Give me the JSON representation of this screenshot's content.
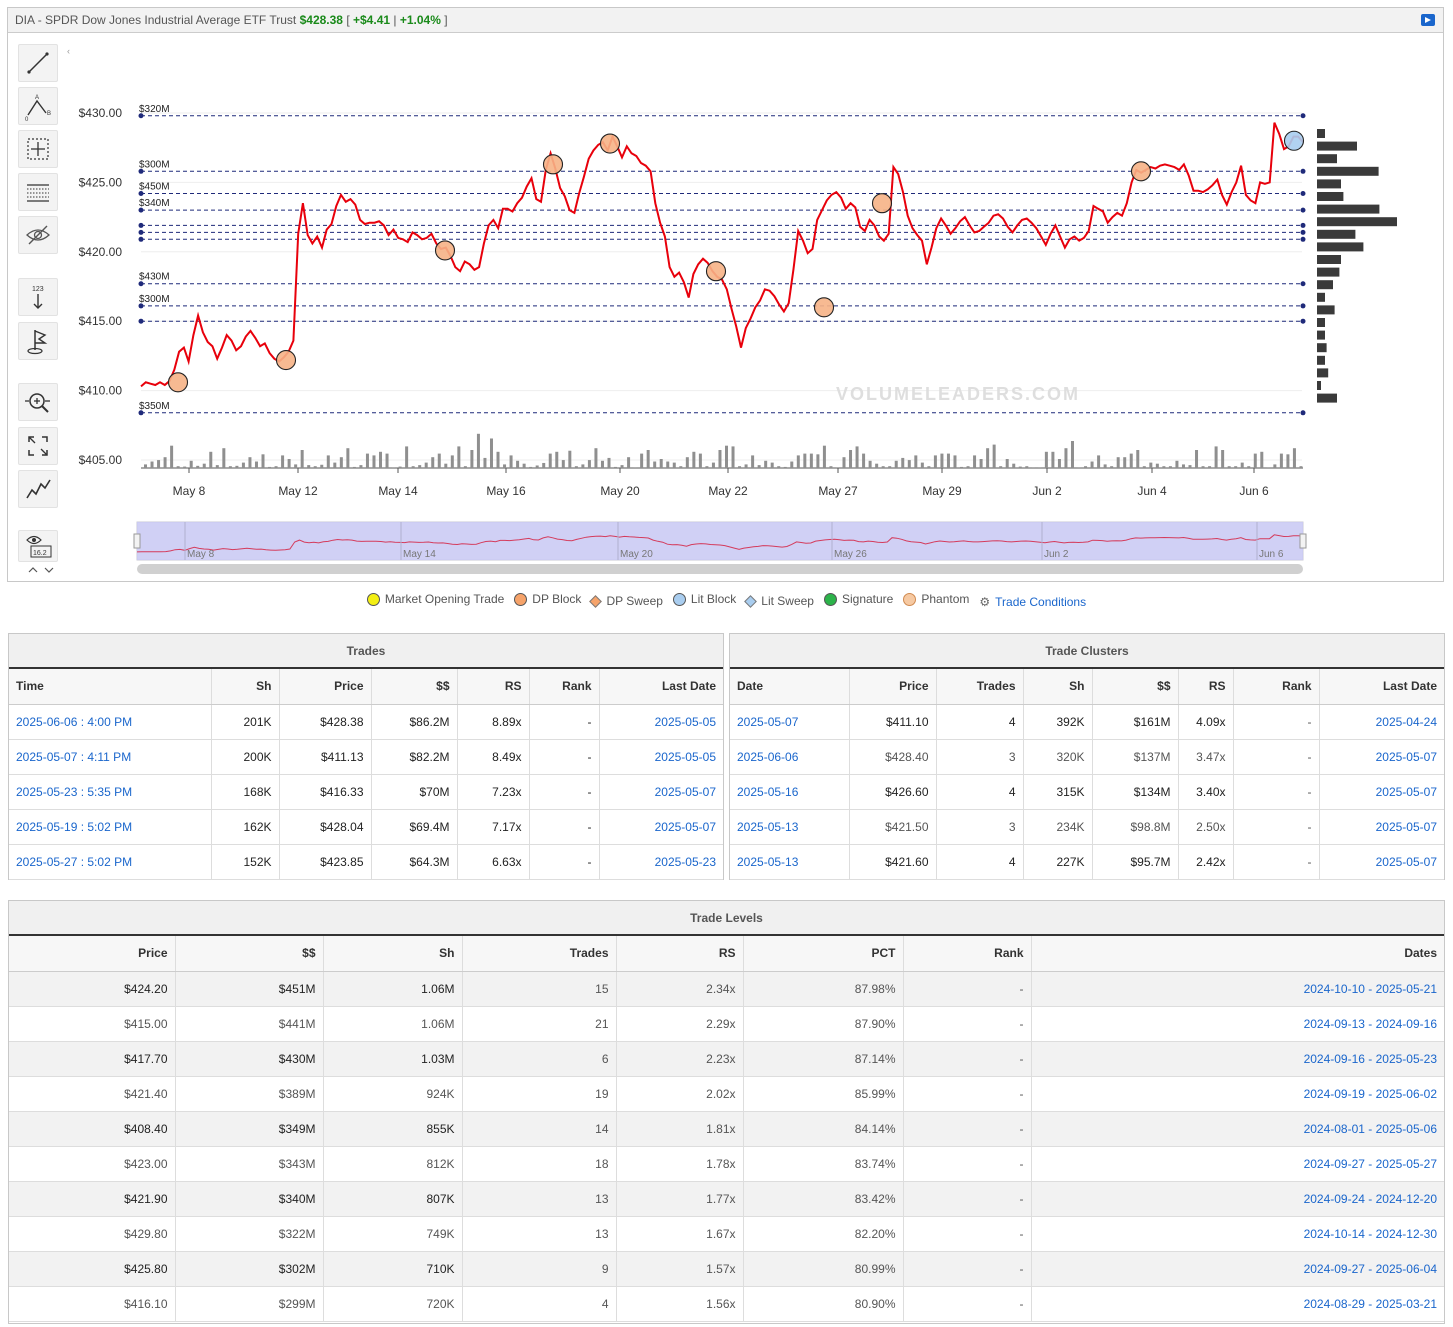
{
  "header": {
    "ticker": "DIA",
    "name": "SPDR Dow Jones Industrial Average ETF Trust",
    "price": "$428.38",
    "change": "+$4.41",
    "change_pct": "+1.04%"
  },
  "toolbar": {
    "tools": [
      "trend-line-icon",
      "abc-pattern-icon",
      "crosshair-icon",
      "grid-icon",
      "hide-icon",
      "measure-icon",
      "flag-icon",
      "zoom-icon",
      "fullscreen-icon",
      "line-chart-icon",
      "eye-value-icon"
    ],
    "eye_value": "16.2",
    "collapse": "‹"
  },
  "watermark": "VOLUMELEADERS.COM",
  "chart_data": {
    "type": "line",
    "title": "",
    "ylim": [
      403.8,
      434.4
    ],
    "y_ticks": [
      405,
      410,
      415,
      420,
      425,
      430
    ],
    "y_tick_labels": [
      "$405.00",
      "$410.00",
      "$415.00",
      "$420.00",
      "$425.00",
      "$430.00"
    ],
    "x_tick_labels": [
      "May 8",
      "May 12",
      "May 14",
      "May 16",
      "May 20",
      "May 22",
      "May 27",
      "May 29",
      "Jun 2",
      "Jun 4",
      "Jun 6"
    ],
    "price_series": [
      {
        "name": "price",
        "values": [
          410.3,
          410.6,
          410.5,
          410.4,
          410.6,
          410.4,
          410.7,
          411.5,
          412.8,
          413.1,
          412.1,
          414.0,
          415.4,
          414.2,
          413.5,
          413.2,
          412.3,
          413.1,
          414.0,
          413.6,
          412.9,
          413.2,
          413.9,
          414.3,
          413.8,
          413.2,
          413.4,
          412.7,
          412.3,
          412.1,
          412.4,
          412.8,
          413.6,
          421.3,
          423.5,
          421.2,
          420.6,
          421.1,
          420.3,
          421.6,
          422.0,
          423.3,
          424.1,
          423.6,
          423.8,
          423.4,
          422.3,
          422.0,
          422.1,
          422.1,
          422.2,
          421.9,
          421.2,
          421.6,
          421.0,
          420.9,
          420.7,
          421.4,
          421.2,
          420.9,
          421.0,
          421.3,
          420.6,
          420.2,
          420.3,
          419.7,
          418.9,
          418.6,
          419.3,
          419.1,
          418.7,
          418.9,
          420.6,
          421.9,
          422.3,
          421.7,
          423.1,
          423.1,
          422.9,
          423.5,
          423.9,
          424.7,
          425.3,
          423.8,
          423.6,
          425.9,
          427.1,
          426.0,
          424.6,
          424.0,
          423.0,
          422.8,
          424.2,
          425.4,
          426.7,
          427.3,
          427.7,
          427.9,
          427.3,
          428.3,
          427.6,
          426.8,
          427.6,
          427.1,
          426.9,
          426.4,
          426.2,
          425.8,
          423.5,
          422.1,
          421.1,
          418.9,
          418.2,
          418.5,
          417.8,
          416.7,
          418.4,
          419.1,
          419.5,
          419.2,
          418.6,
          418.2,
          418.0,
          417.3,
          415.9,
          414.6,
          413.1,
          414.5,
          415.2,
          416.0,
          416.5,
          417.3,
          417.2,
          416.8,
          416.2,
          415.7,
          416.3,
          418.7,
          421.5,
          420.8,
          419.9,
          420.2,
          422.3,
          423.0,
          423.7,
          424.1,
          424.3,
          423.9,
          423.1,
          423.5,
          423.2,
          421.8,
          421.5,
          422.3,
          421.9,
          421.1,
          420.8,
          421.3,
          426.1,
          425.6,
          424.3,
          422.6,
          421.7,
          421.2,
          420.8,
          419.1,
          420.3,
          421.7,
          422.4,
          421.9,
          421.3,
          421.7,
          422.2,
          422.5,
          421.9,
          421.4,
          421.5,
          421.8,
          422.1,
          422.6,
          422.7,
          422.4,
          421.8,
          421.4,
          421.9,
          422.3,
          422.4,
          422.1,
          421.7,
          421.1,
          420.5,
          421.3,
          421.9,
          421.1,
          420.3,
          420.9,
          421.1,
          420.8,
          421.0,
          421.5,
          423.3,
          423.1,
          422.9,
          422.1,
          422.5,
          422.8,
          422.6,
          423.5,
          425.0,
          425.9,
          425.7,
          425.9,
          426.1,
          426.0,
          426.2,
          426.3,
          426.2,
          426.1,
          425.9,
          426.3,
          425.5,
          424.4,
          424.4,
          424.3,
          424.5,
          424.8,
          425.2,
          424.1,
          423.4,
          424.3,
          425.0,
          426.2,
          424.1,
          423.7,
          423.5,
          425.0,
          424.9,
          425.0,
          429.3,
          428.5,
          427.4,
          427.6,
          428.3,
          428.3,
          427.9
        ]
      }
    ],
    "trade_markers": [
      {
        "type": "DP Block",
        "price": 410.6
      },
      {
        "type": "DP Block",
        "price": 412.2
      },
      {
        "type": "DP Block",
        "price": 420.1
      },
      {
        "type": "DP Block",
        "price": 426.3
      },
      {
        "type": "DP Block",
        "price": 427.8
      },
      {
        "type": "DP Block",
        "price": 418.6
      },
      {
        "type": "DP Block",
        "price": 416.0
      },
      {
        "type": "DP Block",
        "price": 423.5
      },
      {
        "type": "DP Block",
        "price": 425.8
      },
      {
        "type": "Lit Block",
        "price": 428.0
      }
    ],
    "levels": [
      {
        "price": 429.8,
        "label": "$320M"
      },
      {
        "price": 425.8,
        "label": "$300M"
      },
      {
        "price": 424.2,
        "label": "$450M"
      },
      {
        "price": 423.0,
        "label": "$340M"
      },
      {
        "price": 421.9,
        "label": ""
      },
      {
        "price": 421.4,
        "label": ""
      },
      {
        "price": 420.9,
        "label": ""
      },
      {
        "price": 417.7,
        "label": "$430M"
      },
      {
        "price": 416.1,
        "label": "$300M"
      },
      {
        "price": 415.0,
        "label": ""
      },
      {
        "price": 408.4,
        "label": "$350M"
      }
    ],
    "volume_bars": [
      0.1,
      0.18,
      0.22,
      0.3,
      0.62,
      0.05,
      0.04,
      0.2,
      0.06,
      0.12,
      0.45,
      0.08,
      0.55,
      0.05,
      0.06,
      0.15,
      0.3,
      0.18,
      0.38,
      0.03,
      0.05,
      0.35,
      0.25,
      0.1,
      0.5,
      0.08,
      0.05,
      0.09,
      0.35,
      0.15,
      0.3,
      0.55,
      0.03,
      0.08,
      0.4,
      0.35,
      0.45,
      0.4,
      0.02,
      0.04,
      0.6,
      0.05,
      0.08,
      0.15,
      0.3,
      0.4,
      0.12,
      0.35,
      0.6,
      0.05,
      0.5,
      0.95,
      0.28,
      0.82,
      0.45,
      0.1,
      0.35,
      0.2,
      0.12,
      0.03,
      0.07,
      0.14,
      0.4,
      0.45,
      0.22,
      0.48,
      0.05,
      0.1,
      0.22,
      0.55,
      0.2,
      0.28,
      0.03,
      0.08,
      0.3,
      0.02,
      0.4,
      0.5,
      0.18,
      0.25,
      0.18,
      0.15,
      0.05,
      0.3,
      0.45,
      0.4,
      0.05,
      0.15,
      0.5,
      0.62,
      0.6,
      0.05,
      0.1,
      0.35,
      0.08,
      0.2,
      0.15,
      0.05,
      0.03,
      0.18,
      0.35,
      0.4,
      0.4,
      0.38,
      0.62,
      0.05,
      0.02,
      0.3,
      0.5,
      0.6,
      0.4,
      0.2,
      0.12,
      0.05,
      0.05,
      0.2,
      0.28,
      0.22,
      0.35,
      0.15,
      0.05,
      0.35,
      0.4,
      0.4,
      0.35,
      0.03,
      0.05,
      0.35,
      0.25,
      0.55,
      0.65,
      0.05,
      0.25,
      0.12,
      0.04,
      0.05,
      0.02,
      0.02,
      0.45,
      0.45,
      0.25,
      0.55,
      0.75,
      0.02,
      0.05,
      0.18,
      0.35,
      0.1,
      0.05,
      0.3,
      0.3,
      0.4,
      0.5,
      0.05,
      0.15,
      0.12,
      0.05,
      0.05,
      0.2,
      0.1,
      0.08,
      0.5,
      0.05,
      0.05,
      0.6,
      0.5,
      0.05,
      0.05,
      0.15,
      0.05,
      0.4,
      0.45,
      0.02,
      0.1,
      0.4,
      0.38,
      0.55,
      0.05
    ],
    "volume_profile": [
      0.1,
      0.5,
      0.25,
      0.77,
      0.3,
      0.33,
      0.78,
      1.0,
      0.48,
      0.58,
      0.3,
      0.28,
      0.2,
      0.1,
      0.22,
      0.1,
      0.1,
      0.12,
      0.1,
      0.14,
      0.05,
      0.25
    ],
    "navigator": {
      "labels": [
        "May 8",
        "May 14",
        "May 20",
        "May 26",
        "Jun 2",
        "Jun 6"
      ]
    }
  },
  "legend": [
    {
      "label": "Market Opening Trade",
      "color": "#f3ef14",
      "shape": "circle"
    },
    {
      "label": "DP Block",
      "color": "#f6a36a",
      "shape": "circle"
    },
    {
      "label": "DP Sweep",
      "color": "#f6a36a",
      "shape": "diamond"
    },
    {
      "label": "Lit Block",
      "color": "#a9cdef",
      "shape": "circle"
    },
    {
      "label": "Lit Sweep",
      "color": "#a9cdef",
      "shape": "diamond"
    },
    {
      "label": "Signature",
      "color": "#2cb34a",
      "shape": "circle"
    },
    {
      "label": "Phantom",
      "color": "#f6c9a2",
      "shape": "phantom"
    },
    {
      "label": "Trade Conditions",
      "color": "#1a66cc",
      "shape": "gear"
    }
  ],
  "trades": {
    "title": "Trades",
    "columns": [
      "Time",
      "Sh",
      "Price",
      "$$",
      "RS",
      "Rank",
      "Last Date"
    ],
    "rows": [
      [
        "2025-06-06 : 4:00 PM",
        "201K",
        "$428.38",
        "$86.2M",
        "8.89x",
        "-",
        "2025-05-05"
      ],
      [
        "2025-05-07 : 4:11 PM",
        "200K",
        "$411.13",
        "$82.2M",
        "8.49x",
        "-",
        "2025-05-05"
      ],
      [
        "2025-05-23 : 5:35 PM",
        "168K",
        "$416.33",
        "$70M",
        "7.23x",
        "-",
        "2025-05-07"
      ],
      [
        "2025-05-19 : 5:02 PM",
        "162K",
        "$428.04",
        "$69.4M",
        "7.17x",
        "-",
        "2025-05-07"
      ],
      [
        "2025-05-27 : 5:02 PM",
        "152K",
        "$423.85",
        "$64.3M",
        "6.63x",
        "-",
        "2025-05-23"
      ]
    ]
  },
  "clusters": {
    "title": "Trade Clusters",
    "columns": [
      "Date",
      "Price",
      "Trades",
      "Sh",
      "$$",
      "RS",
      "Rank",
      "Last Date"
    ],
    "rows": [
      [
        "2025-05-07",
        "$411.10",
        "4",
        "392K",
        "$161M",
        "4.09x",
        "-",
        "2025-04-24"
      ],
      [
        "2025-06-06",
        "$428.40",
        "3",
        "320K",
        "$137M",
        "3.47x",
        "-",
        "2025-05-07"
      ],
      [
        "2025-05-16",
        "$426.60",
        "4",
        "315K",
        "$134M",
        "3.40x",
        "-",
        "2025-05-07"
      ],
      [
        "2025-05-13",
        "$421.50",
        "3",
        "234K",
        "$98.8M",
        "2.50x",
        "-",
        "2025-05-07"
      ],
      [
        "2025-05-13",
        "$421.60",
        "4",
        "227K",
        "$95.7M",
        "2.42x",
        "-",
        "2025-05-07"
      ]
    ]
  },
  "levels_table": {
    "title": "Trade Levels",
    "columns": [
      "Price",
      "$$",
      "Sh",
      "Trades",
      "RS",
      "PCT",
      "Rank",
      "Dates"
    ],
    "rows": [
      [
        "$424.20",
        "$451M",
        "1.06M",
        "15",
        "2.34x",
        "87.98%",
        "-",
        "2024-10-10 - 2025-05-21"
      ],
      [
        "$415.00",
        "$441M",
        "1.06M",
        "21",
        "2.29x",
        "87.90%",
        "-",
        "2024-09-13 - 2024-09-16"
      ],
      [
        "$417.70",
        "$430M",
        "1.03M",
        "6",
        "2.23x",
        "87.14%",
        "-",
        "2024-09-16 - 2025-05-23"
      ],
      [
        "$421.40",
        "$389M",
        "924K",
        "19",
        "2.02x",
        "85.99%",
        "-",
        "2024-09-19 - 2025-06-02"
      ],
      [
        "$408.40",
        "$349M",
        "855K",
        "14",
        "1.81x",
        "84.14%",
        "-",
        "2024-08-01 - 2025-05-06"
      ],
      [
        "$423.00",
        "$343M",
        "812K",
        "18",
        "1.78x",
        "83.74%",
        "-",
        "2024-09-27 - 2025-05-27"
      ],
      [
        "$421.90",
        "$340M",
        "807K",
        "13",
        "1.77x",
        "83.42%",
        "-",
        "2024-09-24 - 2024-12-20"
      ],
      [
        "$429.80",
        "$322M",
        "749K",
        "13",
        "1.67x",
        "82.20%",
        "-",
        "2024-10-14 - 2024-12-30"
      ],
      [
        "$425.80",
        "$302M",
        "710K",
        "9",
        "1.57x",
        "80.99%",
        "-",
        "2024-09-27 - 2025-06-04"
      ],
      [
        "$416.10",
        "$299M",
        "720K",
        "4",
        "1.56x",
        "80.90%",
        "-",
        "2024-08-29 - 2025-03-21"
      ]
    ]
  }
}
